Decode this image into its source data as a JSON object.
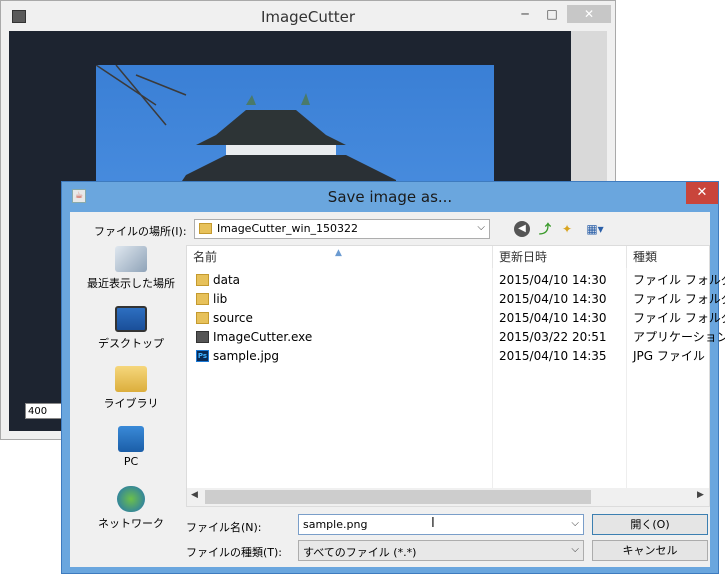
{
  "app": {
    "title": "ImageCutter",
    "width_value": "400",
    "controls": {
      "minimize": "─",
      "maximize": "□",
      "close": "✕"
    }
  },
  "dialog": {
    "title": "Save image as...",
    "close": "✕",
    "location": {
      "label": "ファイルの場所(I):",
      "value": "ImageCutter_win_150322"
    },
    "places": [
      {
        "label": "最近表示した場所",
        "icon": "recent-places-icon"
      },
      {
        "label": "デスクトップ",
        "icon": "desktop-icon"
      },
      {
        "label": "ライブラリ",
        "icon": "libraries-icon"
      },
      {
        "label": "PC",
        "icon": "pc-icon"
      },
      {
        "label": "ネットワーク",
        "icon": "network-icon"
      }
    ],
    "columns": {
      "name": "名前",
      "date": "更新日時",
      "type": "種類"
    },
    "files": [
      {
        "name": "data",
        "date": "2015/04/10 14:30",
        "type": "ファイル フォルダー",
        "icon": "folder-icon"
      },
      {
        "name": "lib",
        "date": "2015/04/10 14:30",
        "type": "ファイル フォルダー",
        "icon": "folder-icon"
      },
      {
        "name": "source",
        "date": "2015/04/10 14:30",
        "type": "ファイル フォルダー",
        "icon": "folder-icon"
      },
      {
        "name": "ImageCutter.exe",
        "date": "2015/03/22 20:51",
        "type": "アプリケーション",
        "icon": "exe-icon"
      },
      {
        "name": "sample.jpg",
        "date": "2015/04/10 14:35",
        "type": "JPG ファイル",
        "icon": "photoshop-icon"
      }
    ],
    "filename": {
      "label": "ファイル名(N):",
      "value": "sample.png"
    },
    "filetype": {
      "label": "ファイルの種類(T):",
      "value": "すべてのファイル (*.*)"
    },
    "buttons": {
      "open": "開く(O)",
      "cancel": "キャンセル"
    }
  },
  "colors": {
    "dialog_frame": "#6aa6de",
    "close_red": "#c9453b",
    "sky": "#3a7fd5"
  }
}
